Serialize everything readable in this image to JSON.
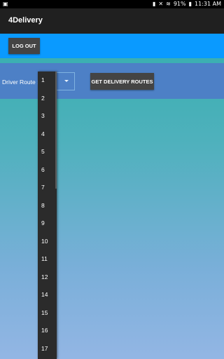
{
  "status_bar": {
    "battery": "91%",
    "time": "11:31 AM"
  },
  "app_bar": {
    "title": "4Delivery"
  },
  "toolbar": {
    "logout_label": "LOG OUT"
  },
  "route": {
    "label": "Driver Route :",
    "selected": "1",
    "get_routes_label": "GET DELIVERY ROUTES"
  },
  "dropdown": {
    "options": [
      "1",
      "2",
      "3",
      "4",
      "5",
      "6",
      "7",
      "8",
      "9",
      "10",
      "11",
      "12",
      "14",
      "15",
      "16",
      "17"
    ]
  }
}
